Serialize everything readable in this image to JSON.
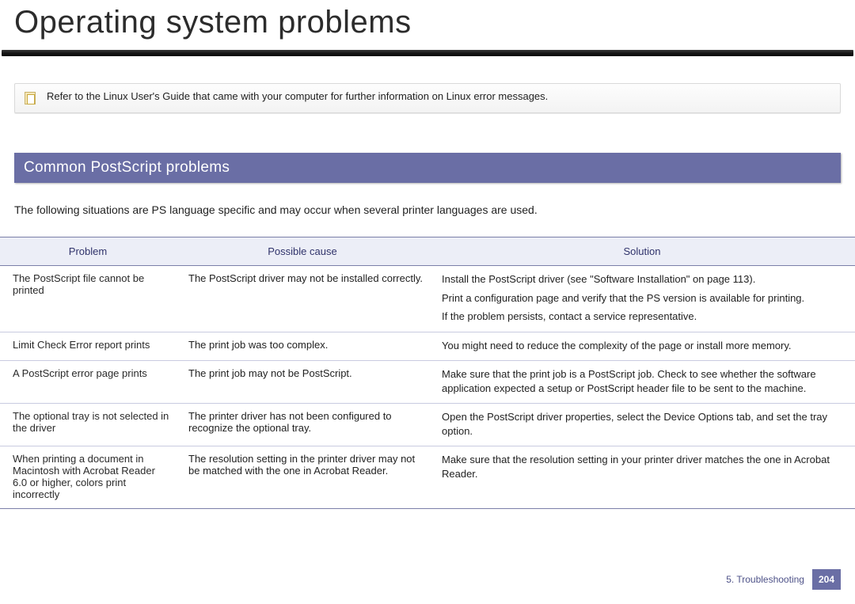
{
  "pageTitle": "Operating system problems",
  "note": "Refer to the Linux User's Guide that came with your computer for further information on Linux error messages.",
  "sectionHeader": "Common PostScript problems",
  "sectionIntro": "The following situations are PS language specific and may occur when several printer languages are used.",
  "table": {
    "headers": {
      "problem": "Problem",
      "cause": "Possible cause",
      "solution": "Solution"
    },
    "rows": [
      {
        "problem": "The PostScript file cannot be printed",
        "cause": "The PostScript driver may not be installed correctly.",
        "solutions": [
          "Install the PostScript driver (see \"Software Installation\" on page 113).",
          "Print a configuration page and verify that the PS version is available for printing.",
          "If the problem persists, contact a service representative."
        ]
      },
      {
        "problem": "Limit Check Error report prints",
        "cause": "The print job was too complex.",
        "solutions": [
          "You might need to reduce the complexity of the page or install more memory."
        ]
      },
      {
        "problem": "A PostScript error page prints",
        "cause": "The print job may not be PostScript.",
        "solutions": [
          "Make sure that the print job is a PostScript job. Check to see whether the software application expected a setup or PostScript header file to be sent to the machine."
        ]
      },
      {
        "problem": "The optional tray is not selected in the driver",
        "cause": "The printer driver has not been configured to recognize the optional tray.",
        "solutions": [
          "Open the PostScript driver properties, select the Device Options tab, and set the tray option."
        ]
      },
      {
        "problem": "When printing a document in Macintosh with Acrobat Reader 6.0 or higher, colors print incorrectly",
        "cause": "The resolution setting in the printer driver may not be matched with the one in Acrobat Reader.",
        "solutions": [
          "Make sure that the resolution setting in your printer driver matches the one in Acrobat Reader."
        ]
      }
    ]
  },
  "footer": {
    "chapter": "5. Troubleshooting",
    "page": "204"
  }
}
